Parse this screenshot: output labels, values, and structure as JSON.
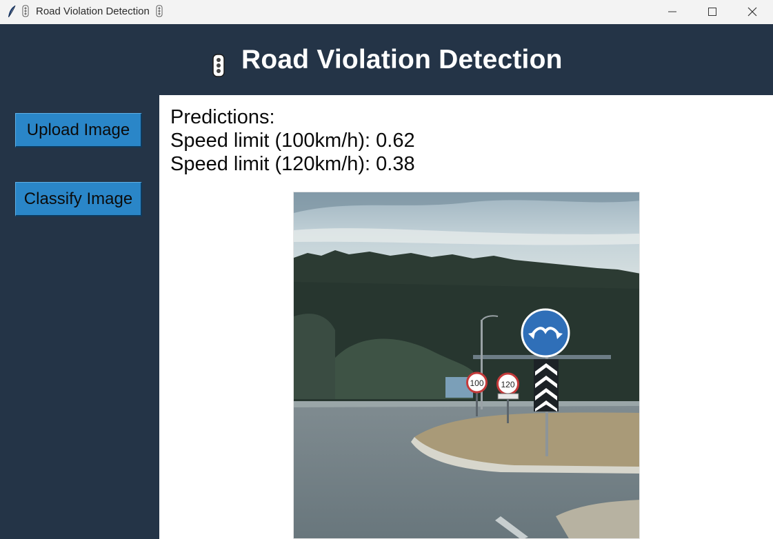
{
  "window": {
    "title": "Road Violation Detection",
    "controls": [
      "minimize",
      "maximize",
      "close"
    ]
  },
  "header": {
    "title": "Road Violation Detection",
    "icon": "traffic-light-icon"
  },
  "sidebar": {
    "upload_label": "Upload Image",
    "classify_label": "Classify Image",
    "button_color": "#2a86c8"
  },
  "main": {
    "predictions_heading": "Predictions:",
    "predictions": [
      "Speed limit (100km/h): 0.62",
      "Speed limit (120km/h): 0.38"
    ],
    "image": {
      "sign_labels": [
        "100",
        "120"
      ]
    }
  },
  "colors": {
    "background": "#243447",
    "panel": "#ffffff",
    "titlebar": "#f3f3f3"
  }
}
